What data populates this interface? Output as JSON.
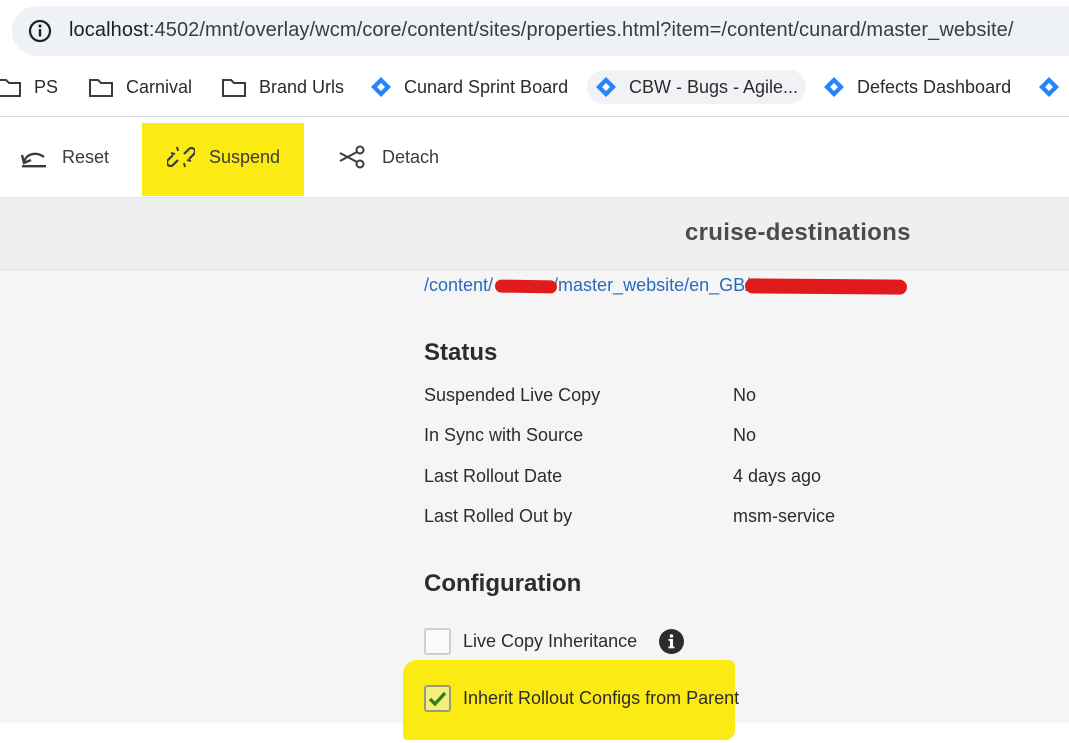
{
  "browser": {
    "url_host": "localhost",
    "url_rest": ":4502/mnt/overlay/wcm/core/content/sites/properties.html?item=/content/cunard/master_website/"
  },
  "bookmarks": {
    "items": [
      {
        "label": "PS",
        "icon": "folder-icon"
      },
      {
        "label": "Carnival",
        "icon": "folder-icon"
      },
      {
        "label": "Brand Urls",
        "icon": "folder-icon"
      },
      {
        "label": "Cunard Sprint Board",
        "icon": "jira-icon"
      },
      {
        "label": "CBW - Bugs - Agile...",
        "icon": "jira-icon"
      },
      {
        "label": "Defects Dashboard",
        "icon": "jira-icon"
      }
    ]
  },
  "actions": {
    "reset": "Reset",
    "suspend": "Suspend",
    "detach": "Detach"
  },
  "page": {
    "title": "cruise-destinations",
    "path_prefix": "/content/",
    "path_middle": "/master_website/en_GB/"
  },
  "status": {
    "heading": "Status",
    "rows": [
      {
        "label": "Suspended Live Copy",
        "value": "No"
      },
      {
        "label": "In Sync with Source",
        "value": "No"
      },
      {
        "label": "Last Rollout Date",
        "value": "4 days ago"
      },
      {
        "label": "Last Rolled Out by",
        "value": "msm-service"
      }
    ]
  },
  "configuration": {
    "heading": "Configuration",
    "live_copy_inheritance": {
      "label": "Live Copy Inheritance",
      "checked": false
    },
    "inherit_rollout": {
      "label": "Inherit Rollout Configs from Parent",
      "checked": true
    }
  },
  "colors": {
    "highlight": "#fbeb13",
    "link": "#2a6bbd",
    "redaction": "#e11b1b",
    "jira_blue": "#2684ff"
  }
}
